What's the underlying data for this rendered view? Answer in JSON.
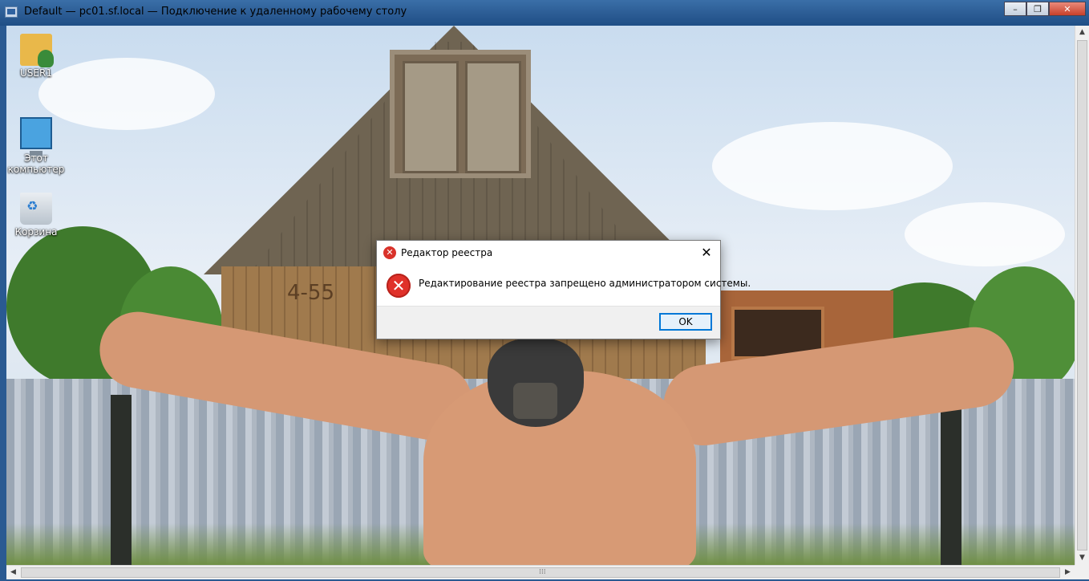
{
  "window": {
    "title": "Default — pc01.sf.local — Подключение к удаленному рабочему столу",
    "minimize_glyph": "–",
    "restore_glyph": "❐",
    "close_glyph": "✕"
  },
  "desktop": {
    "icons": [
      {
        "label": "USER1",
        "icon": "user-folder-icon"
      },
      {
        "label": "Этот компьютер",
        "icon": "computer-icon"
      },
      {
        "label": "Корзина",
        "icon": "recycle-bin-icon"
      }
    ],
    "wallpaper": {
      "house_number": "4-55"
    }
  },
  "dialog": {
    "title": "Редактор реестра",
    "message": "Редактирование реестра запрещено администратором системы.",
    "ok_label": "OK",
    "close_glyph": "✕",
    "error_glyph": "✕"
  },
  "scrollbars": {
    "up_arrow": "▲",
    "down_arrow": "▼",
    "left_arrow": "◀",
    "right_arrow": "▶",
    "grip": "⁞⁞⁞"
  },
  "colors": {
    "titlebar": "#2a5a92",
    "error_red": "#e0312a",
    "ok_border": "#0078d7"
  }
}
